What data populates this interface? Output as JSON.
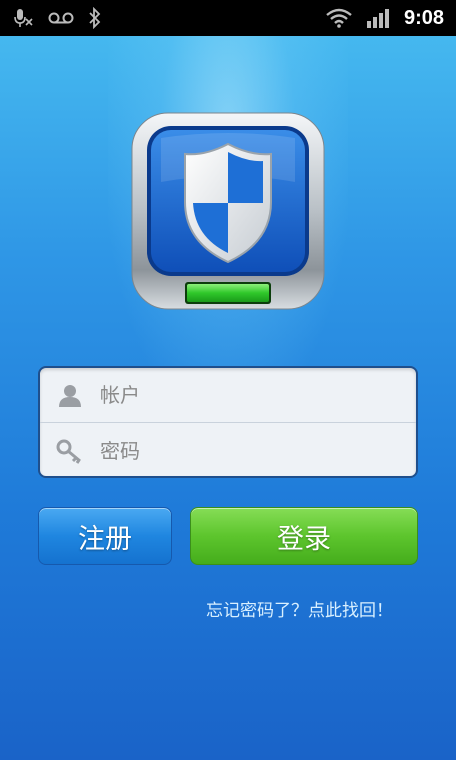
{
  "status_bar": {
    "time": "9:08",
    "icons": [
      "mic-muted-icon",
      "voicemail-icon",
      "bluetooth-icon",
      "wifi-icon",
      "signal-icon"
    ]
  },
  "app": {
    "icon": "shield-icon",
    "colors": {
      "background_top": "#45b8ef",
      "background_bottom": "#1a63c8",
      "register_button": "#1f86e0",
      "login_button": "#5dc52d"
    }
  },
  "form": {
    "account": {
      "placeholder": "帐户",
      "value": "",
      "icon": "user-icon"
    },
    "password": {
      "placeholder": "密码",
      "value": "",
      "icon": "key-icon"
    }
  },
  "buttons": {
    "register_label": "注册",
    "login_label": "登录"
  },
  "links": {
    "forgot_password": "忘记密码了？点此找回！"
  }
}
